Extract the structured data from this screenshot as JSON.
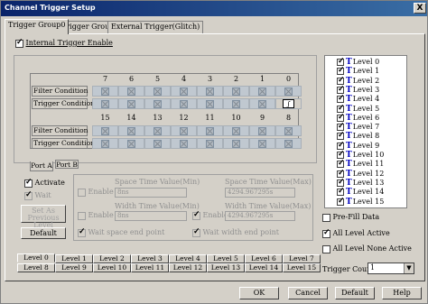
{
  "window": {
    "title": "Channel Trigger Setup",
    "close_label": "X"
  },
  "tabs": [
    "Trigger Group0",
    "Trigger Group1",
    "External Trigger(Glitch)"
  ],
  "internal_enable": {
    "label": "Internal Trigger Enable",
    "checked": true
  },
  "grid": {
    "top_headers": [
      "7",
      "6",
      "5",
      "4",
      "3",
      "2",
      "1",
      "0"
    ],
    "bottom_headers": [
      "15",
      "14",
      "13",
      "12",
      "11",
      "10",
      "9",
      "8"
    ],
    "filter_label": "Filter Condition",
    "trigger_label": "Trigger Condition"
  },
  "port_tabs": [
    "Port A",
    "Port B"
  ],
  "left_panel": {
    "activate": "Activate",
    "wait": "Wait",
    "set_prev": "Set As Previous Level",
    "default": "Default"
  },
  "space": {
    "enable": "Enable",
    "min_label": "Space Time Value(Min)",
    "min_value": "8ns",
    "max_label": "Space Time Value(Max)",
    "max_value": "4294.967295s",
    "wait_end": "Wait space end point"
  },
  "width": {
    "enable": "Enable",
    "min_label": "Width Time Value(Min)",
    "min_value": "8ns",
    "max_enable": "Enable",
    "max_label": "Width Time Value(Max)",
    "max_value": "4294.967295s",
    "wait_end": "Wait width end point"
  },
  "level_tabs_row1": [
    "Level 0",
    "Level 1",
    "Level 2",
    "Level 3",
    "Level 4",
    "Level 5",
    "Level 6",
    "Level 7"
  ],
  "level_tabs_row2": [
    "Level 8",
    "Level 9",
    "Level 10",
    "Level 11",
    "Level 12",
    "Level 13",
    "Level 14",
    "Level 15"
  ],
  "levels": [
    "Level 0",
    "Level 1",
    "Level 2",
    "Level 3",
    "Level 4",
    "Level 5",
    "Level 6",
    "Level 7",
    "Level 8",
    "Level 9",
    "Level 10",
    "Level 11",
    "Level 12",
    "Level 13",
    "Level 14",
    "Level 15"
  ],
  "level_icon": "T",
  "prefill": "Pre-Fill Data",
  "all_active": "All Level Active",
  "all_none": "All Level None Active",
  "trigger_count": {
    "label": "Trigger Count",
    "value": "1"
  },
  "buttons": {
    "ok": "OK",
    "cancel": "Cancel",
    "default": "Default",
    "help": "Help"
  }
}
